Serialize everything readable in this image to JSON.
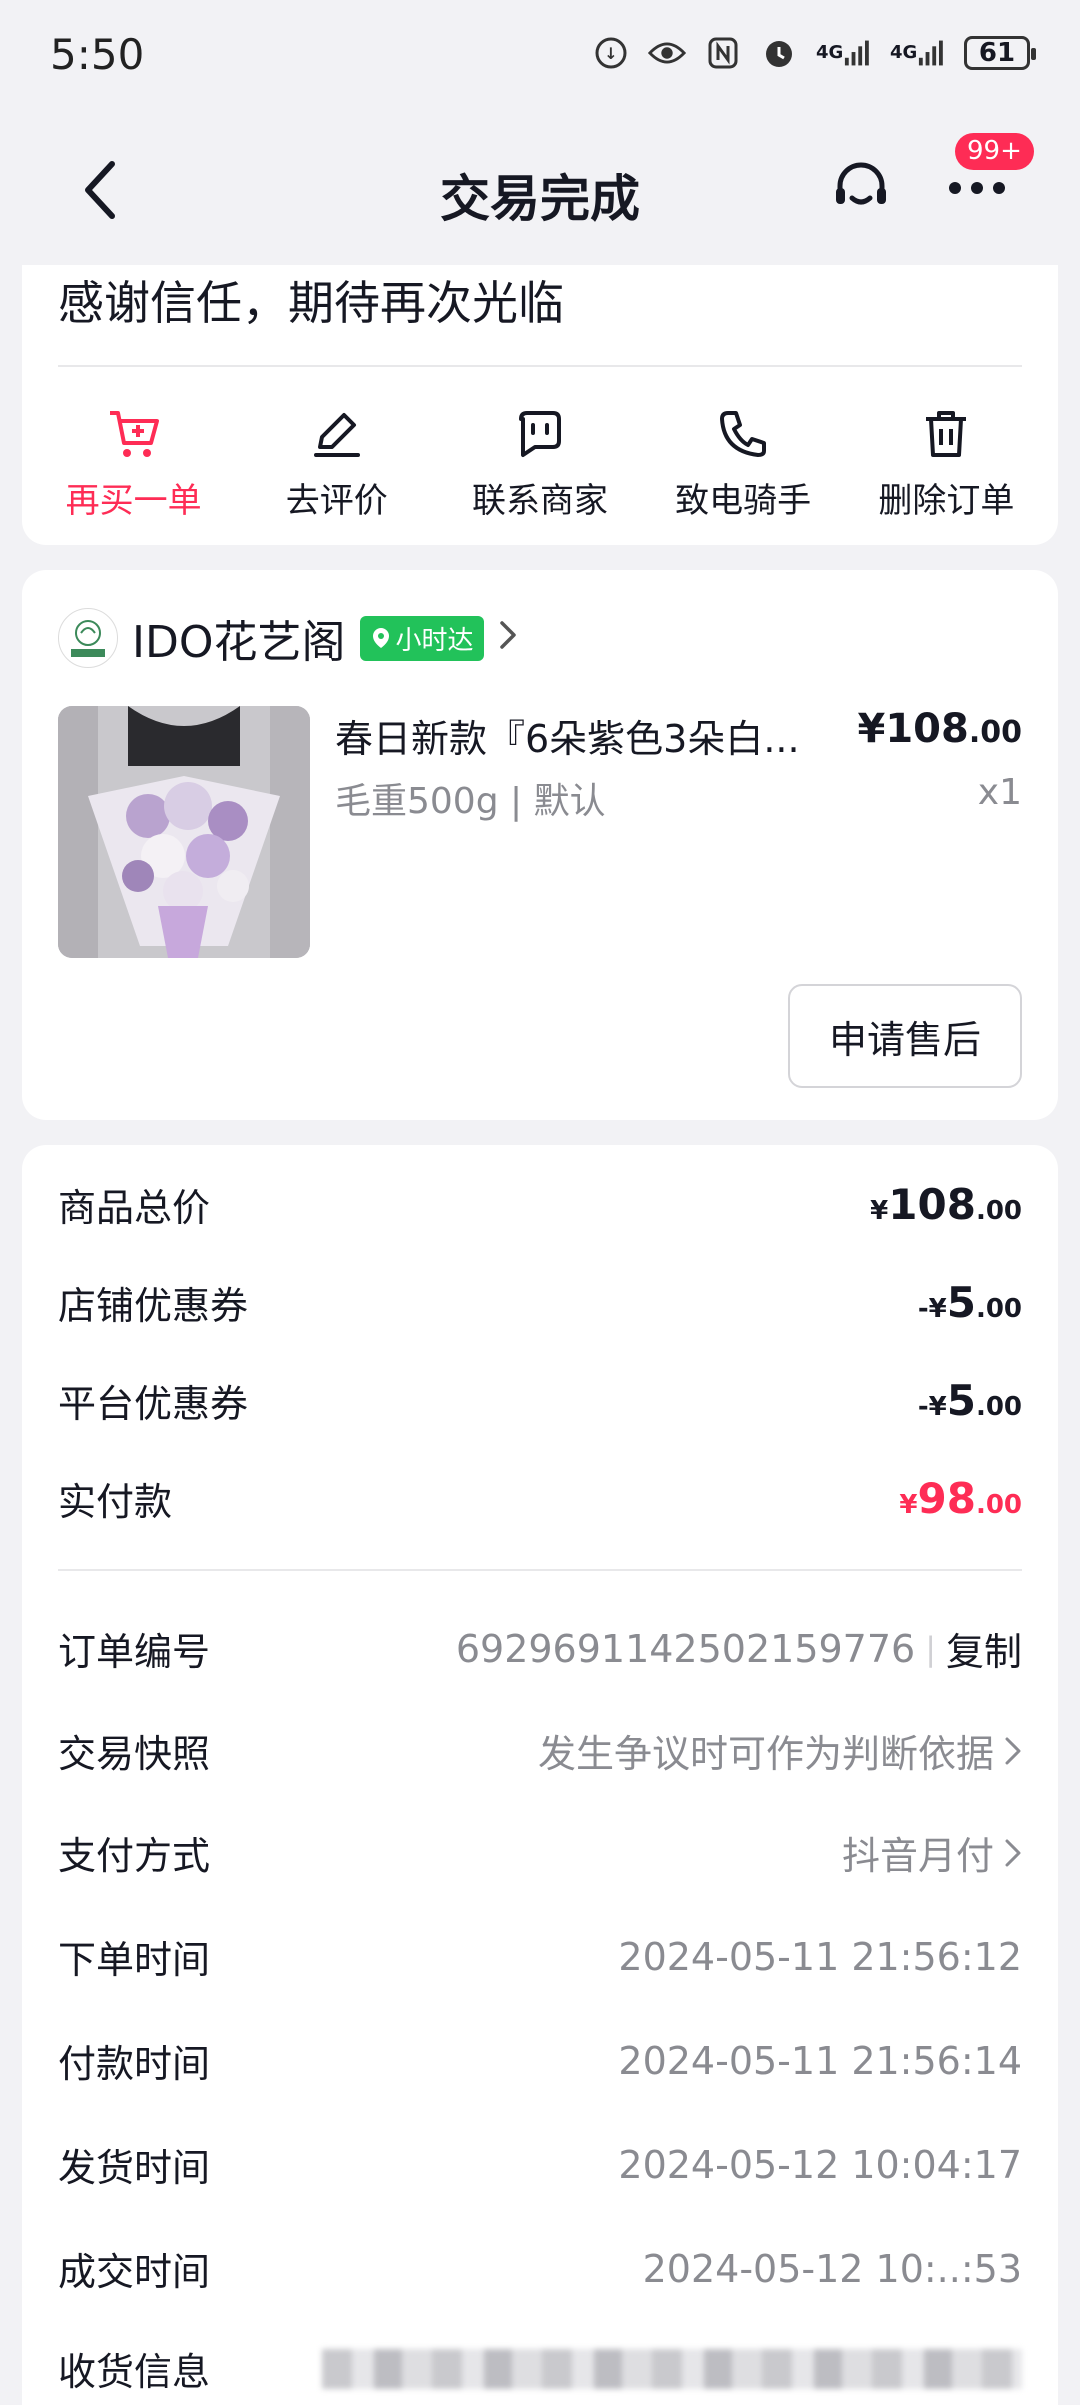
{
  "status_bar": {
    "time": "5:50",
    "battery": "61",
    "net1": "4G",
    "net2": "4G"
  },
  "nav": {
    "title": "交易完成",
    "badge": "99+"
  },
  "top_card": {
    "thanks": "感谢信任，期待再次光临",
    "actions": [
      {
        "label": "再买一单",
        "icon": "cart-plus-icon"
      },
      {
        "label": "去评价",
        "icon": "pencil-icon"
      },
      {
        "label": "联系商家",
        "icon": "chat-icon"
      },
      {
        "label": "致电骑手",
        "icon": "phone-icon"
      },
      {
        "label": "删除订单",
        "icon": "trash-icon"
      }
    ]
  },
  "product_card": {
    "shop_name": "IDO花艺阁",
    "shop_tag": "小时达",
    "title": "春日新款『6朵紫色3朵白...",
    "price_symbol": "¥",
    "price_int": "108",
    "price_dec": ".00",
    "spec": "毛重500g | 默认",
    "qty": "x1",
    "aftersale_label": "申请售后"
  },
  "detail_card": {
    "rows": [
      {
        "label": "商品总价",
        "sign": "¥",
        "int": "108",
        "dec": ".00"
      },
      {
        "label": "店铺优惠券",
        "sign": "-¥",
        "int": "5",
        "dec": ".00"
      },
      {
        "label": "平台优惠券",
        "sign": "-¥",
        "int": "5",
        "dec": ".00"
      },
      {
        "label": "实付款",
        "sign": "¥",
        "int": "98",
        "dec": ".00"
      }
    ],
    "order_no_label": "订单编号",
    "order_no": "6929691142502159776",
    "copy_label": "复制",
    "snapshot_label": "交易快照",
    "snapshot_value": "发生争议时可作为判断依据",
    "pay_label": "支付方式",
    "pay_value": "抖音月付",
    "times": [
      {
        "label": "下单时间",
        "value": "2024-05-11 21:56:12"
      },
      {
        "label": "付款时间",
        "value": "2024-05-11 21:56:14"
      },
      {
        "label": "发货时间",
        "value": "2024-05-12 10:04:17"
      },
      {
        "label": "成交时间",
        "value": "2024-05-12 10:..:53"
      }
    ],
    "receive_label": "收货信息"
  },
  "colors": {
    "accent": "#fe2c55",
    "hour_tag": "#22c25a",
    "muted": "#8a8b91"
  }
}
